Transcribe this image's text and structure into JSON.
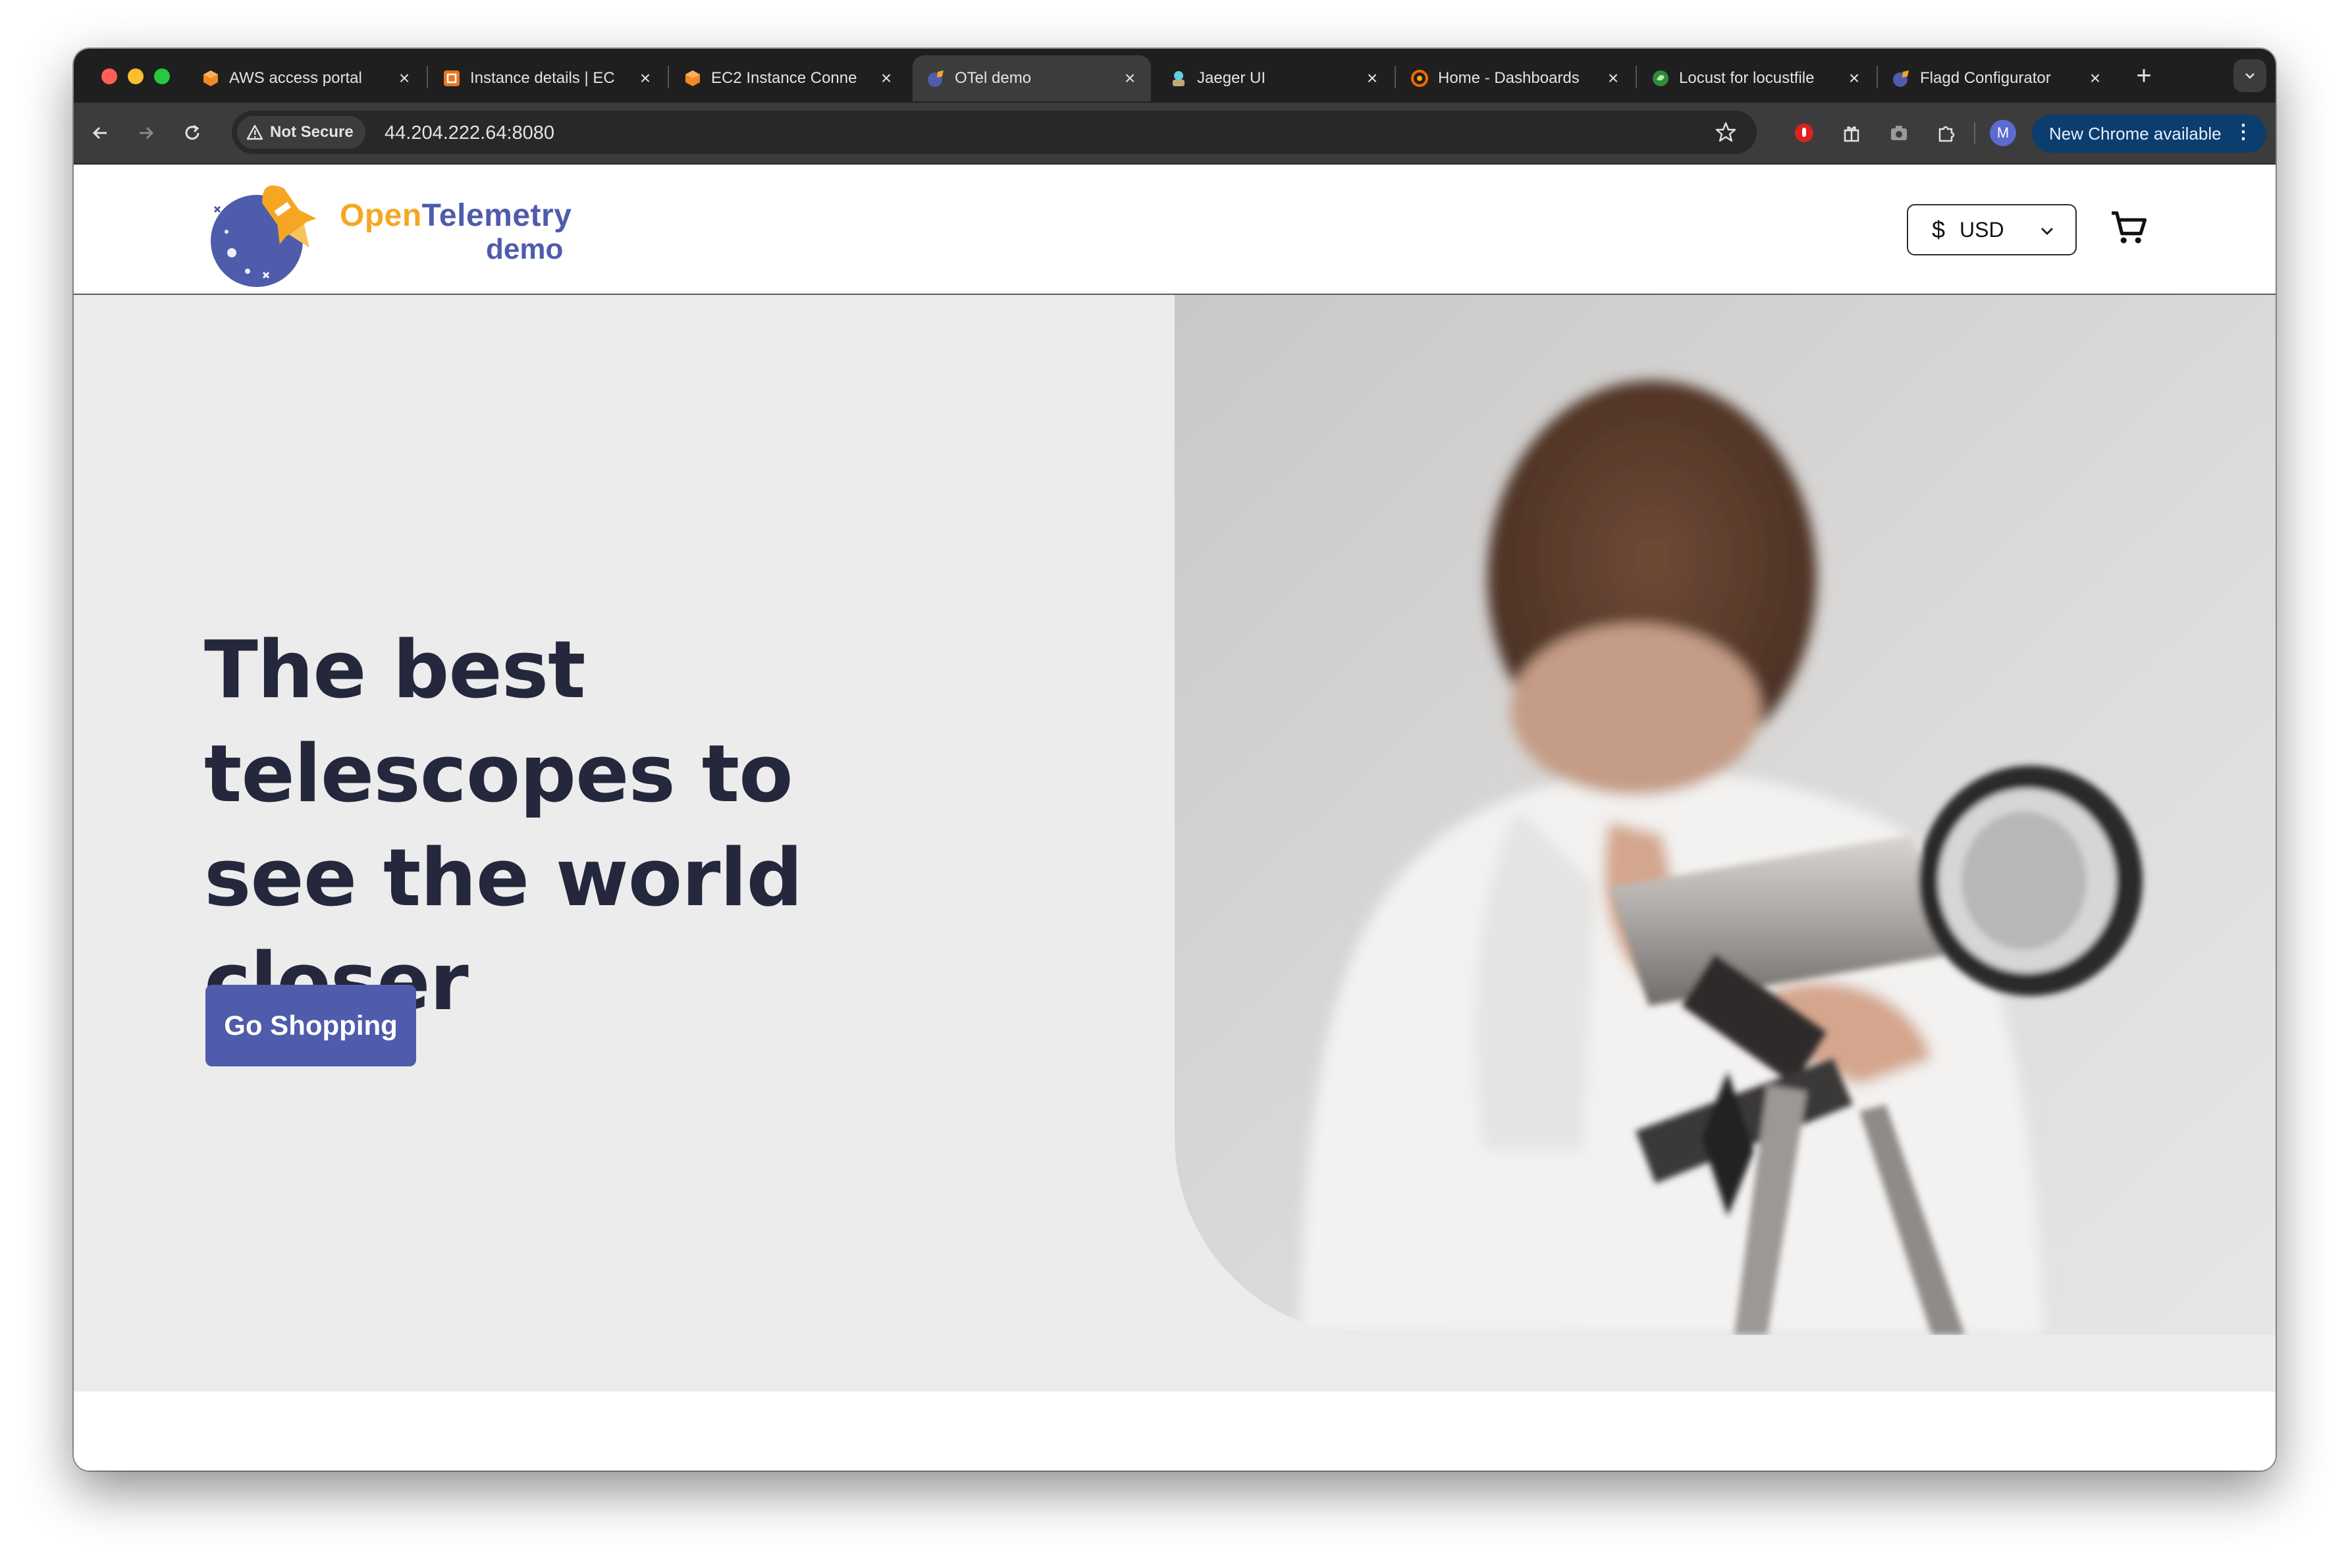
{
  "browser": {
    "tabs": [
      {
        "title": "AWS access portal",
        "icon": "aws-cube-icon",
        "active": false
      },
      {
        "title": "Instance details | EC",
        "icon": "ec2-icon",
        "active": false
      },
      {
        "title": "EC2 Instance Conne",
        "icon": "aws-cube-icon",
        "active": false
      },
      {
        "title": "OTel demo",
        "icon": "otel-icon",
        "active": true
      },
      {
        "title": "Jaeger UI",
        "icon": "jaeger-icon",
        "active": false
      },
      {
        "title": "Home - Dashboards",
        "icon": "grafana-icon",
        "active": false
      },
      {
        "title": "Locust for locustfile",
        "icon": "locust-icon",
        "active": false
      },
      {
        "title": "Flagd Configurator",
        "icon": "otel-icon",
        "active": false
      }
    ],
    "security_chip": "Not Secure",
    "url": "44.204.222.64:8080",
    "profile_initial": "M",
    "update_button": "New Chrome available"
  },
  "site": {
    "logo": {
      "word1": "Open",
      "word2": "Telemetry",
      "word3": "demo"
    },
    "currency": {
      "symbol": "$",
      "code": "USD"
    },
    "hero": {
      "title": "The best telescopes to see the world closer",
      "button": "Go Shopping"
    }
  },
  "colors": {
    "accent": "#4f5bab",
    "logo_orange": "#f5a623",
    "hero_bg": "#ececed",
    "title_text": "#25283c"
  }
}
